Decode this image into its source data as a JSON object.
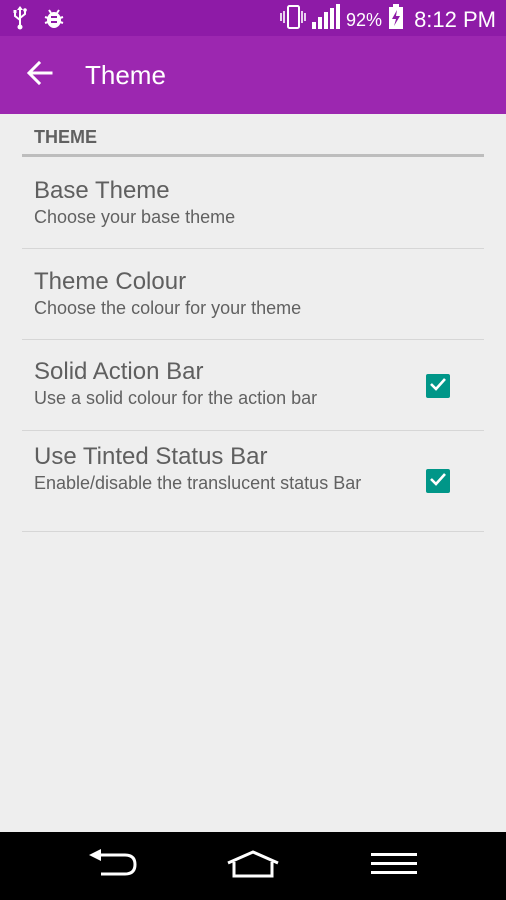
{
  "status_bar": {
    "battery_percent": "92%",
    "time": "8:12 PM",
    "icons": [
      "usb-icon",
      "debug-bug-icon",
      "vibrate-icon",
      "signal-icon",
      "battery-charging-icon"
    ]
  },
  "app_bar": {
    "title": "Theme",
    "back_icon": "arrow-back-icon",
    "color": "#9c27b0"
  },
  "section": {
    "header": "THEME"
  },
  "preferences": [
    {
      "title": "Base Theme",
      "summary": "Choose your base theme"
    },
    {
      "title": "Theme Colour",
      "summary": "Choose the colour for your theme"
    },
    {
      "title": "Solid Action Bar",
      "summary": "Use a solid colour for the action bar",
      "checked": true
    },
    {
      "title": "Use Tinted Status Bar",
      "summary": "Enable/disable the translucent status Bar",
      "checked": true
    }
  ],
  "colors": {
    "status_bar": "#8e1ba7",
    "checkbox": "#009688",
    "background": "#eeeeee"
  },
  "nav_bar": {
    "icons": [
      "back-nav-icon",
      "home-nav-icon",
      "menu-nav-icon"
    ]
  }
}
